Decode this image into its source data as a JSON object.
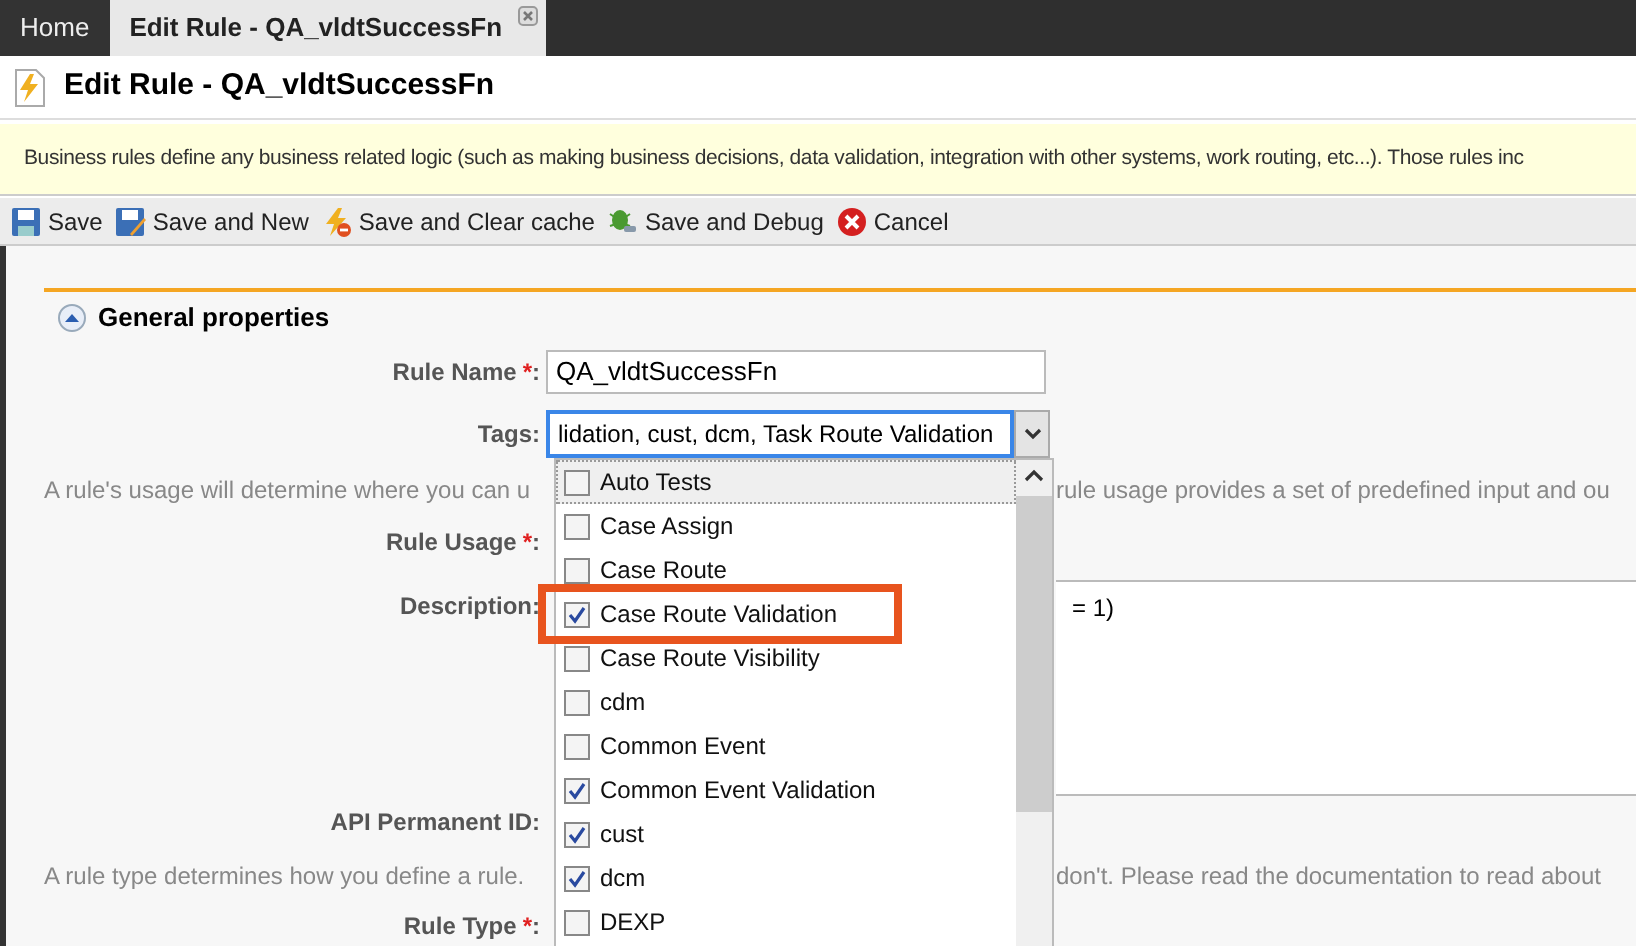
{
  "tabs": [
    {
      "label": "Home",
      "selected": false,
      "closable": false
    },
    {
      "label": "Edit Rule - QA_vldtSuccessFn",
      "selected": true,
      "closable": true
    }
  ],
  "header": {
    "title": "Edit Rule - QA_vldtSuccessFn"
  },
  "info_banner": "Business rules define any business related logic (such as making business decisions, data validation, integration with other systems, work routing, etc...). Those rules inc",
  "toolbar": [
    {
      "label": "Save",
      "kind": "save"
    },
    {
      "label": "Save and New",
      "kind": "save_new"
    },
    {
      "label": "Save and Clear cache",
      "kind": "clear_cache"
    },
    {
      "label": "Save and Debug",
      "kind": "debug"
    },
    {
      "label": "Cancel",
      "kind": "cancel"
    }
  ],
  "section": {
    "title": "General properties",
    "expanded": true
  },
  "rule_name": {
    "label": "Rule Name",
    "required_mark": "*",
    "suffix": ":",
    "value": "QA_vldtSuccessFn"
  },
  "tags": {
    "label": "Tags",
    "suffix": ":",
    "value": "lidation, cust, dcm, Task Route Validation",
    "focused": true,
    "options": [
      {
        "label": "Auto Tests",
        "checked": false,
        "hovered": true,
        "highlighted": false
      },
      {
        "label": "Case Assign",
        "checked": false,
        "hovered": false,
        "highlighted": false
      },
      {
        "label": "Case Route",
        "checked": false,
        "hovered": false,
        "highlighted": false
      },
      {
        "label": "Case Route Validation",
        "checked": true,
        "hovered": false,
        "highlighted": true
      },
      {
        "label": "Case Route Visibility",
        "checked": false,
        "hovered": false,
        "highlighted": false
      },
      {
        "label": "cdm",
        "checked": false,
        "hovered": false,
        "highlighted": false
      },
      {
        "label": "Common Event",
        "checked": false,
        "hovered": false,
        "highlighted": false
      },
      {
        "label": "Common Event Validation",
        "checked": true,
        "hovered": false,
        "highlighted": false
      },
      {
        "label": "cust",
        "checked": true,
        "hovered": false,
        "highlighted": false
      },
      {
        "label": "dcm",
        "checked": true,
        "hovered": false,
        "highlighted": false
      },
      {
        "label": "DEXP",
        "checked": false,
        "hovered": false,
        "highlighted": false
      }
    ]
  },
  "usage_hint": {
    "left": "A rule's usage will determine where you can u",
    "right": "rule usage provides a set of predefined input and ou"
  },
  "rule_usage": {
    "label": "Rule Usage",
    "required_mark": "*",
    "suffix": ":"
  },
  "description": {
    "label": "Description",
    "suffix": ":",
    "value": "= 1)"
  },
  "api_id": {
    "label": "API Permanent ID",
    "suffix": ":"
  },
  "type_hint": {
    "left": "A rule type determines how you define a rule.",
    "right": "don't. Please read the documentation to read about"
  },
  "rule_type": {
    "label": "Rule Type",
    "required_mark": "*",
    "suffix": ":"
  }
}
